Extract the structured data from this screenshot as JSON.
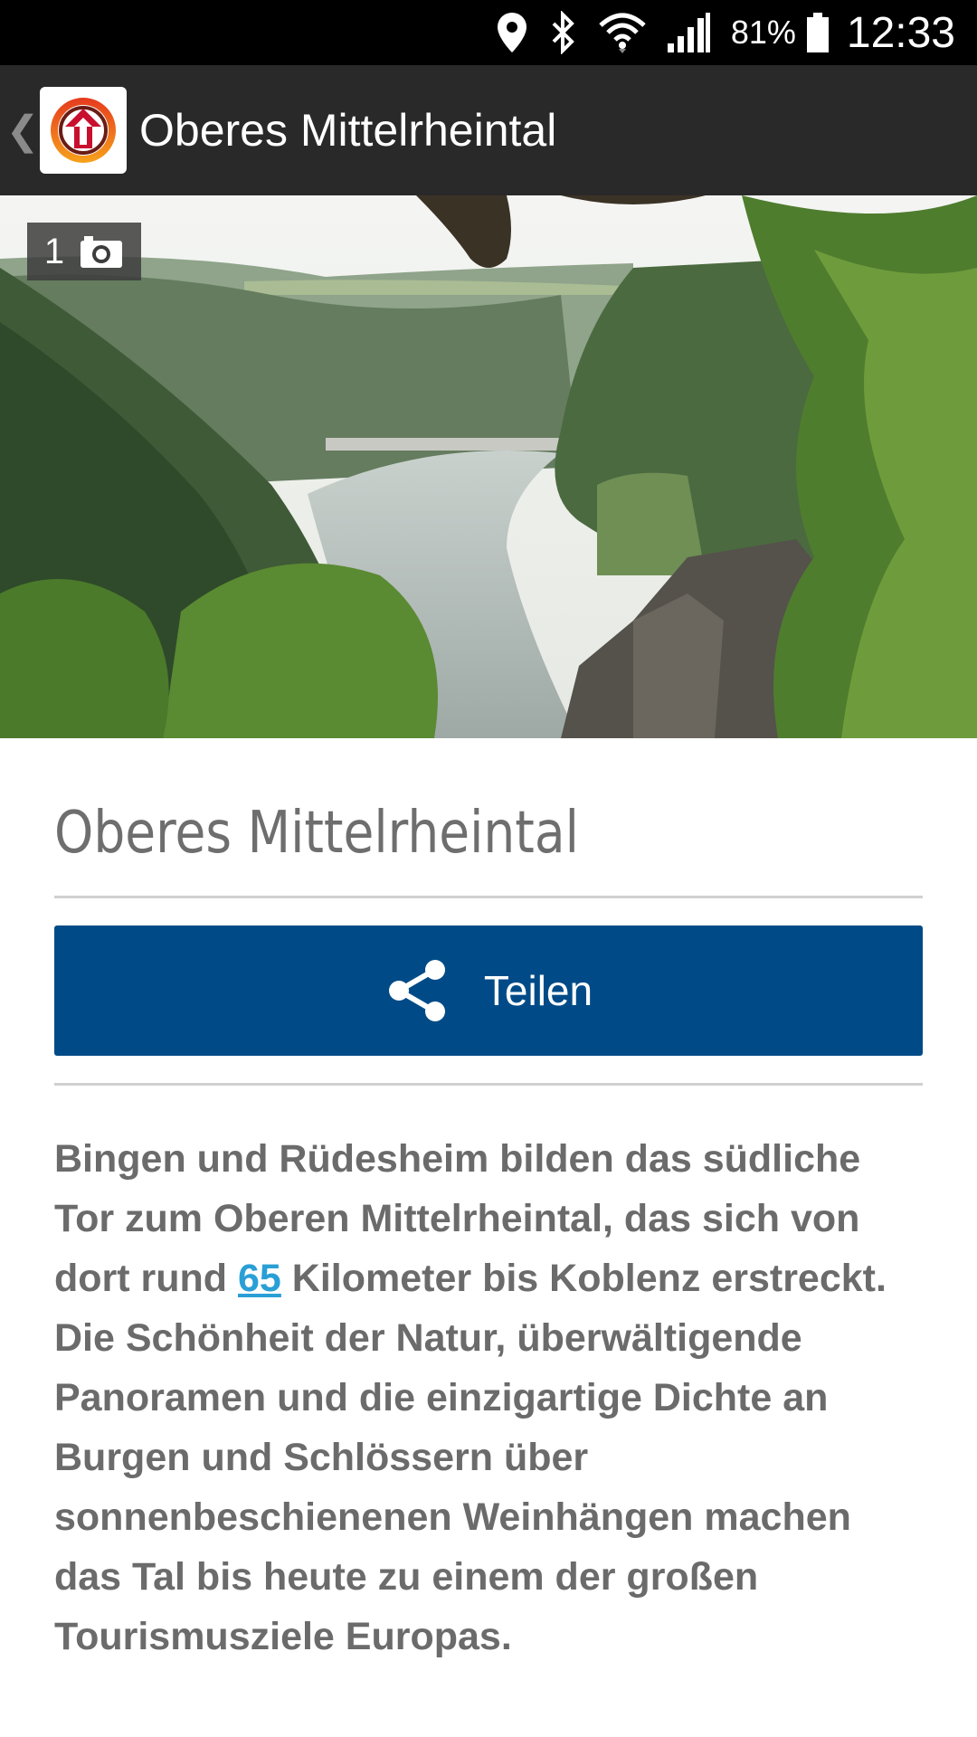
{
  "status_bar": {
    "battery_percent": "81%",
    "time": "12:33",
    "icons": [
      "location-icon",
      "bluetooth-icon",
      "wifi-icon",
      "signal-icon",
      "battery-icon"
    ]
  },
  "app_bar": {
    "title": "Oberes Mittelrheintal",
    "back_glyph": "❮"
  },
  "hero": {
    "photo_count": "1"
  },
  "content": {
    "title": "Oberes Mittelrheintal",
    "share_label": "Teilen",
    "description": {
      "before_link": "Bingen und Rüdesheim bilden das südliche Tor zum Oberen Mittelrheintal, das sich von dort rund ",
      "link_text": "65",
      "after_link": " Kilometer bis Koblenz erstreckt. Die Schönheit der Natur, überwältigende Panoramen und die einzigartige Dichte an Burgen und Schlössern über sonnenbeschienenen Weinhängen machen das Tal bis heute zu einem der großen Tourismusziele Europas."
    }
  },
  "colors": {
    "status_bar_bg": "#000000",
    "app_bar_bg": "#292929",
    "share_button_bg": "#004b87",
    "link": "#2a9fd6",
    "text": "#6b6b6b"
  }
}
